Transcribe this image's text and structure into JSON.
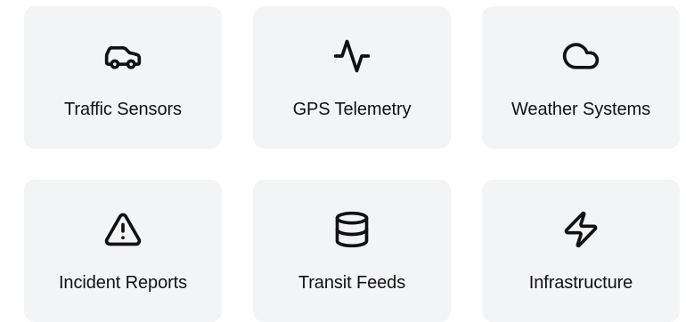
{
  "categories": [
    {
      "label": "Traffic Sensors",
      "icon": "car-icon"
    },
    {
      "label": "GPS Telemetry",
      "icon": "activity-icon"
    },
    {
      "label": "Weather Systems",
      "icon": "cloud-icon"
    },
    {
      "label": "Incident Reports",
      "icon": "warning-triangle-icon"
    },
    {
      "label": "Transit Feeds",
      "icon": "database-icon"
    },
    {
      "label": "Infrastructure",
      "icon": "lightning-bolt-icon"
    }
  ],
  "colors": {
    "card_background": "#f3f4f6",
    "text": "#111111",
    "icon_stroke": "#111111"
  }
}
